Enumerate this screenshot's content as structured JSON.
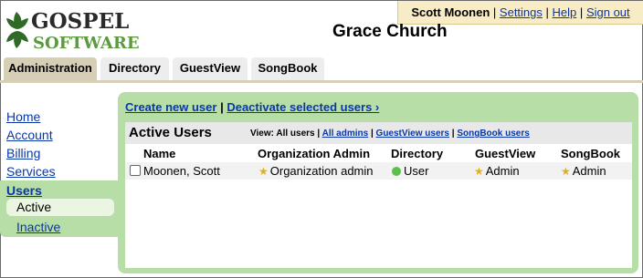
{
  "logo": {
    "line1": "GOSPEL",
    "line2": "SOFTWARE"
  },
  "userbar": {
    "name": "Scott Moonen",
    "settings": "Settings",
    "help": "Help",
    "signout": "Sign out",
    "sep": "|"
  },
  "org_name": "Grace Church",
  "tabs": [
    {
      "label": "Administration"
    },
    {
      "label": "Directory"
    },
    {
      "label": "GuestView"
    },
    {
      "label": "SongBook"
    }
  ],
  "sidebar": {
    "items": [
      "Home",
      "Account",
      "Billing",
      "Services"
    ],
    "users": "Users",
    "active": "Active",
    "inactive": "Inactive"
  },
  "actions": {
    "create": "Create new user",
    "sep": "|",
    "deactivate": "Deactivate selected users ›"
  },
  "table": {
    "title": "Active Users",
    "views_prefix": "View: All users |",
    "view_all_admins": "All admins",
    "view_guestview": "GuestView users",
    "view_songbook": "SongBook users",
    "sep": "|",
    "columns": [
      "Name",
      "Organization Admin",
      "Directory",
      "GuestView",
      "SongBook"
    ],
    "rows": [
      {
        "name": "Moonen, Scott",
        "org_admin": "Organization admin",
        "directory": "User",
        "guestview": "Admin",
        "songbook": "Admin"
      }
    ]
  },
  "colors": {
    "panel": "#b8dea7",
    "link": "#0a37a6",
    "tab_active": "#d6cfb6",
    "userbar": "#f7ecc6"
  }
}
